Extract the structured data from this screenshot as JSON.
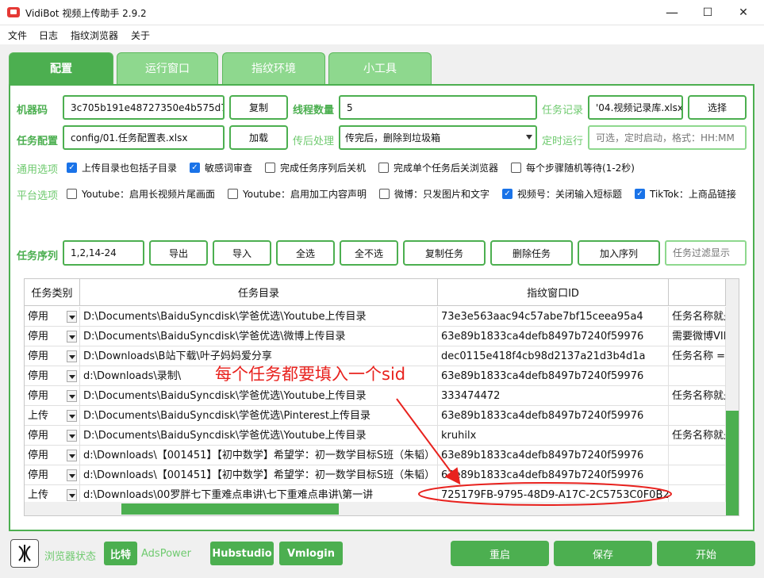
{
  "window": {
    "title": "VidiBot 视频上传助手 2.9.2",
    "min": "—",
    "max": "☐",
    "close": "✕"
  },
  "menu": [
    "文件",
    "日志",
    "指纹浏览器",
    "关于"
  ],
  "tabs": [
    "配置",
    "运行窗口",
    "指纹环境",
    "小工具"
  ],
  "config": {
    "machine_code_label": "机器码",
    "machine_code": "3c705b191e48727350e4b575d7",
    "copy_btn": "复制",
    "threads_label": "线程数量",
    "threads": "5",
    "task_record_label": "任务记录",
    "task_record": "'04.视频记录库.xlsx",
    "choose_btn": "选择",
    "task_config_label": "任务配置",
    "task_config": "config/01.任务配置表.xlsx",
    "load_btn": "加载",
    "post_label": "传后处理",
    "post_value": "传完后，删除到垃圾箱",
    "schedule_label": "定时运行",
    "schedule_placeholder": "可选，定时启动，格式：HH:MM"
  },
  "general": {
    "label": "通用选项",
    "options": [
      {
        "text": "上传目录也包括子目录",
        "checked": true
      },
      {
        "text": "敏感词审查",
        "checked": true
      },
      {
        "text": "完成任务序列后关机",
        "checked": false
      },
      {
        "text": "完成单个任务后关浏览器",
        "checked": false
      },
      {
        "text": "每个步骤随机等待(1-2秒)",
        "checked": false
      }
    ]
  },
  "platform": {
    "label": "平台选项",
    "options": [
      {
        "text": "Youtube：启用长视频片尾画面",
        "checked": false
      },
      {
        "text": "Youtube：启用加工内容声明",
        "checked": false
      },
      {
        "text": "微博：只发图片和文字",
        "checked": false
      },
      {
        "text": "视频号：关闭输入短标题",
        "checked": true
      },
      {
        "text": "TikTok：上商品链接",
        "checked": true
      }
    ]
  },
  "sequence": {
    "label": "任务序列",
    "value": "1,2,14-24",
    "buttons": [
      "导出",
      "导入",
      "全选",
      "全不选",
      "复制任务",
      "删除任务",
      "加入序列"
    ],
    "filter_placeholder": "任务过滤显示"
  },
  "grid": {
    "headers": [
      "任务类别",
      "任务目录",
      "指纹窗口ID",
      ""
    ],
    "rows": [
      {
        "cat": "停用",
        "dir": "D:\\Documents\\BaiduSyncdisk\\学爸优选\\Youtube上传目录",
        "id": "73e3e563aac94c57abe7bf15ceea95a4",
        "extra": "任务名称就是"
      },
      {
        "cat": "停用",
        "dir": "D:\\Documents\\BaiduSyncdisk\\学爸优选\\微博上传目录",
        "id": "63e89b1833ca4defb8497b7240f59976",
        "extra": "需要微博VIP"
      },
      {
        "cat": "停用",
        "dir": "D:\\Downloads\\B站下载\\叶子妈妈爱分享",
        "id": "dec0115e418f4cb98d2137a21d3b4d1a",
        "extra": "任务名称 ="
      },
      {
        "cat": "停用",
        "dir": "d:\\Downloads\\录制\\",
        "id": "63e89b1833ca4defb8497b7240f59976",
        "extra": ""
      },
      {
        "cat": "停用",
        "dir": "D:\\Documents\\BaiduSyncdisk\\学爸优选\\Youtube上传目录",
        "id": "333474472",
        "extra": "任务名称就是"
      },
      {
        "cat": "上传",
        "dir": "D:\\Documents\\BaiduSyncdisk\\学爸优选\\Pinterest上传目录",
        "id": "63e89b1833ca4defb8497b7240f59976",
        "extra": ""
      },
      {
        "cat": "停用",
        "dir": "D:\\Documents\\BaiduSyncdisk\\学爸优选\\Youtube上传目录",
        "id": "kruhilx",
        "extra": "任务名称就是"
      },
      {
        "cat": "停用",
        "dir": "d:\\Downloads\\【001451】【初中数学】希望学：初一数学目标S班（朱韬）",
        "id": "63e89b1833ca4defb8497b7240f59976",
        "extra": ""
      },
      {
        "cat": "停用",
        "dir": "d:\\Downloads\\【001451】【初中数学】希望学：初一数学目标S班（朱韬）",
        "id": "63e89b1833ca4defb8497b7240f59976",
        "extra": ""
      },
      {
        "cat": "上传",
        "dir": "d:\\Downloads\\00罗胖七下重难点串讲\\七下重难点串讲\\第一讲",
        "id": "725179FB-9795-48D9-A17C-2C5753C0F0B2",
        "extra": ""
      }
    ]
  },
  "annotation": "每个任务都要填入一个sid",
  "bottom": {
    "status_label": "浏览器状态",
    "browsers": [
      "比特",
      "AdsPower",
      "Hubstudio",
      "Vmlogin"
    ],
    "actions": [
      "重启",
      "保存",
      "开始"
    ]
  },
  "colors": {
    "accent": "#4caf50",
    "accent_light": "#8ed88e",
    "annotation": "#e8221e",
    "checkbox": "#1a73e8"
  }
}
